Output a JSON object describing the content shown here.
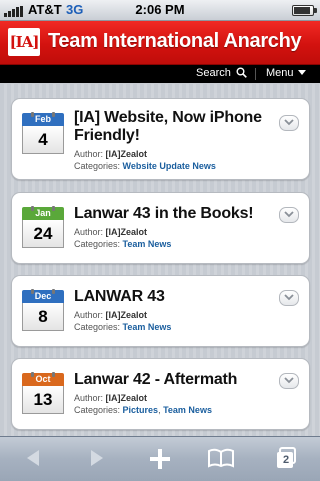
{
  "status_bar": {
    "carrier": "AT&T",
    "network": "3G",
    "time": "2:06 PM"
  },
  "header": {
    "logo_text": "[IA]",
    "site_title": "Team International Anarchy"
  },
  "nav": {
    "search_label": "Search",
    "menu_label": "Menu"
  },
  "posts": [
    {
      "month": "Feb",
      "day": "4",
      "month_color": "#2f6fbf",
      "title": "[IA] Website, Now iPhone Friendly!",
      "author_label": "Author:",
      "author": "[IA]Zealot",
      "categories_label": "Categories:",
      "categories": [
        "Website Update News"
      ]
    },
    {
      "month": "Jan",
      "day": "24",
      "month_color": "#5aa83a",
      "title": "Lanwar 43 in the Books!",
      "author_label": "Author:",
      "author": "[IA]Zealot",
      "categories_label": "Categories:",
      "categories": [
        "Team News"
      ]
    },
    {
      "month": "Dec",
      "day": "8",
      "month_color": "#2f6fbf",
      "title": "LANWAR 43",
      "author_label": "Author:",
      "author": "[IA]Zealot",
      "categories_label": "Categories:",
      "categories": [
        "Team News"
      ]
    },
    {
      "month": "Oct",
      "day": "13",
      "month_color": "#d9681d",
      "title": "Lanwar 42 - Aftermath",
      "author_label": "Author:",
      "author": "[IA]Zealot",
      "categories_label": "Categories:",
      "categories": [
        "Pictures",
        "Team News"
      ],
      "category_separator": ", "
    }
  ],
  "toolbar": {
    "pages_count": "2"
  }
}
